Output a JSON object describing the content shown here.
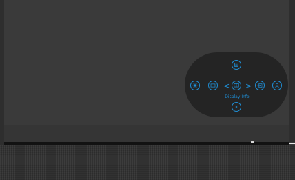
{
  "osd": {
    "selected_label": "Display Info",
    "chevron_left": "<",
    "chevron_right": ">"
  },
  "colors": {
    "accent": "#1f8fd6",
    "osd_background": "#242424",
    "screen_background": "#3a3a3a"
  },
  "icons": {
    "top": "menu-icon",
    "left_outer": "brightness-icon",
    "left_inner": "input-source-icon",
    "center": "display-info-icon",
    "right_inner": "exit-icon",
    "right_outer": "user-icon",
    "bottom": "close-icon"
  }
}
